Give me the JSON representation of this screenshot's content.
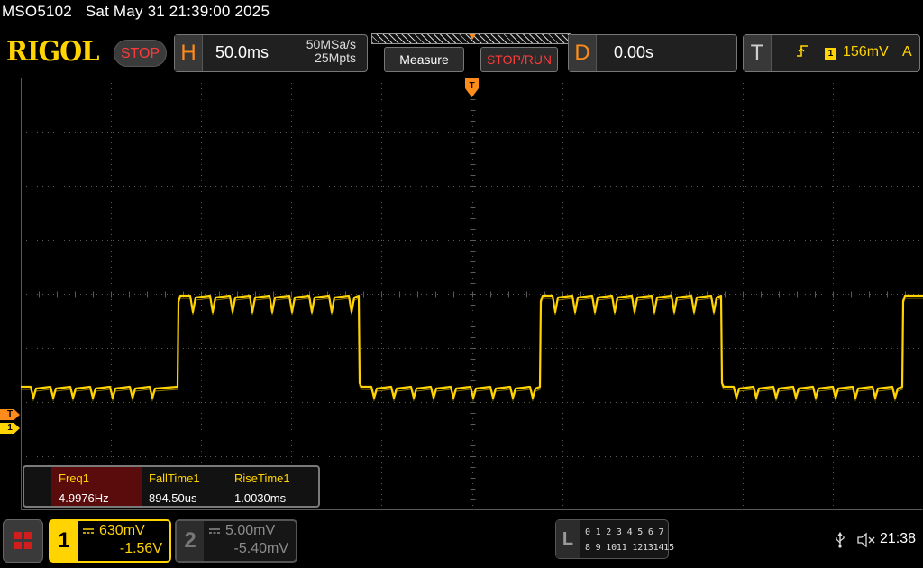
{
  "title_line": {
    "model": "MSO5102",
    "datetime": "Sat May 31 21:39:00 2025"
  },
  "header": {
    "brand": "RIGOL",
    "run_state": "STOP",
    "horizontal": {
      "letter": "H",
      "timebase": "50.0ms",
      "sample_rate": "50MSa/s",
      "memory_depth": "25Mpts"
    },
    "softkeys": {
      "measure": "Measure",
      "stop_run": "STOP/RUN"
    },
    "delay": {
      "letter": "D",
      "value": "0.00s"
    },
    "trigger": {
      "letter": "T",
      "source": "1",
      "level": "156mV",
      "mode": "A"
    }
  },
  "markers": {
    "trigger_level": "T",
    "channel1_ground": "1",
    "trigger_position": "T"
  },
  "measurements": [
    {
      "name": "Freq1",
      "value": "4.9976Hz"
    },
    {
      "name": "FallTime1",
      "value": "894.50us"
    },
    {
      "name": "RiseTime1",
      "value": "1.0030ms"
    }
  ],
  "channels": [
    {
      "num": "1",
      "scale": "630mV",
      "offset": "-1.56V",
      "color": "#ffd400",
      "active": true
    },
    {
      "num": "2",
      "scale": "5.00mV",
      "offset": "-5.40mV",
      "color": "#8c8c8c",
      "active": false
    }
  ],
  "logic": {
    "letter": "L",
    "row1": "0 1 2 3  4 5 6 7",
    "row2": "8 9 1011 12131415"
  },
  "status": {
    "time": "21:38",
    "usb_icon": "usb-icon",
    "sound_icon": "mute-icon"
  },
  "colors": {
    "channel1": "#ffd400",
    "accent_orange": "#ff8c1a",
    "stop_red": "#ff3a3a",
    "grid": "#5a5a5a"
  }
}
